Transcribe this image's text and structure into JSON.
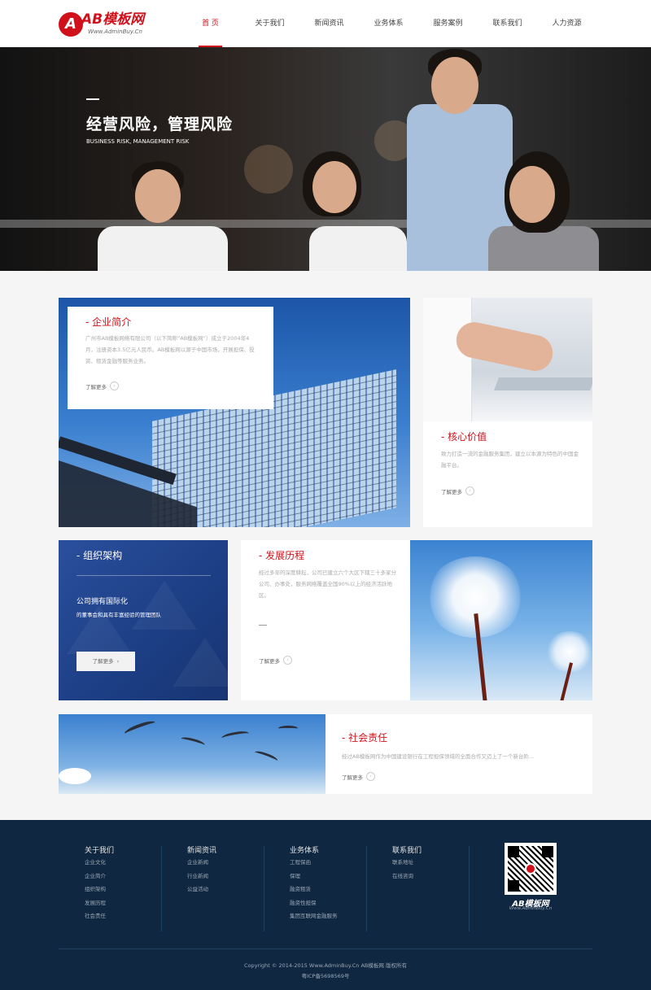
{
  "header": {
    "logo_text": "AB模板网",
    "logo_sub": "Www.AdminBuy.Cn",
    "nav": [
      "首 页",
      "关于我们",
      "新闻资讯",
      "业务体系",
      "服务案例",
      "联系我们",
      "人力资源"
    ]
  },
  "banner": {
    "title": "经营风险，管理风险",
    "subtitle": "BUSINESS RISK, MANAGEMENT RISK"
  },
  "profile": {
    "title": "- 企业简介",
    "text": "广州市AB模板网络有限公司（以下简称“AB模板网”）成立于2004年4月，注册资本3.5亿元人民币。AB模板网以源于中国市场，开展担保、投资、租赁金融等服务业务。",
    "more": "了解更多"
  },
  "values": {
    "title": "- 核心价值",
    "text": "致力打造一流的金融服务集团，建立以本源为特色的中国金融平台。",
    "more": "了解更多"
  },
  "org": {
    "title": "- 组织架构",
    "heading": "公司拥有国际化",
    "subheading": "的董事会和具有丰富经验的管理团队",
    "button": "了解更多"
  },
  "history": {
    "title": "- 发展历程",
    "text": "经过多年的深度耕耘，公司已建立六个大区下辖三十多家分公司、办事处，服务网络覆盖全国90%以上的经济活跃地区。",
    "more": "了解更多"
  },
  "social": {
    "title": "- 社会责任",
    "text": "经过AB模板网作为中国建设银行在工程担保领域的全面合作又迈上了一个新台阶...",
    "more": "了解更多"
  },
  "footer": {
    "columns": [
      {
        "title": "关于我们",
        "links": [
          "企业文化",
          "企业简介",
          "组织架构",
          "发展历程",
          "社会责任"
        ]
      },
      {
        "title": "新闻资讯",
        "links": [
          "企业新闻",
          "行业新闻",
          "公益活动"
        ]
      },
      {
        "title": "业务体系",
        "links": [
          "工程保函",
          "保理",
          "融资租赁",
          "融资性担保",
          "集团互联网金融服务"
        ]
      },
      {
        "title": "联系我们",
        "links": [
          "联系地址",
          "在线咨询"
        ]
      }
    ],
    "logo_text": "AB模板网",
    "logo_sub": "Www.AdminBuy.Cn",
    "copyright": "Copyright © 2014-2015 Www.AdminBuy.Cn AB模板网 版权所有",
    "icp": "粤ICP备5698569号"
  },
  "colors": {
    "brand_red": "#d0111b",
    "footer_bg": "#0f2740",
    "org_blue": "#1d3f86"
  }
}
